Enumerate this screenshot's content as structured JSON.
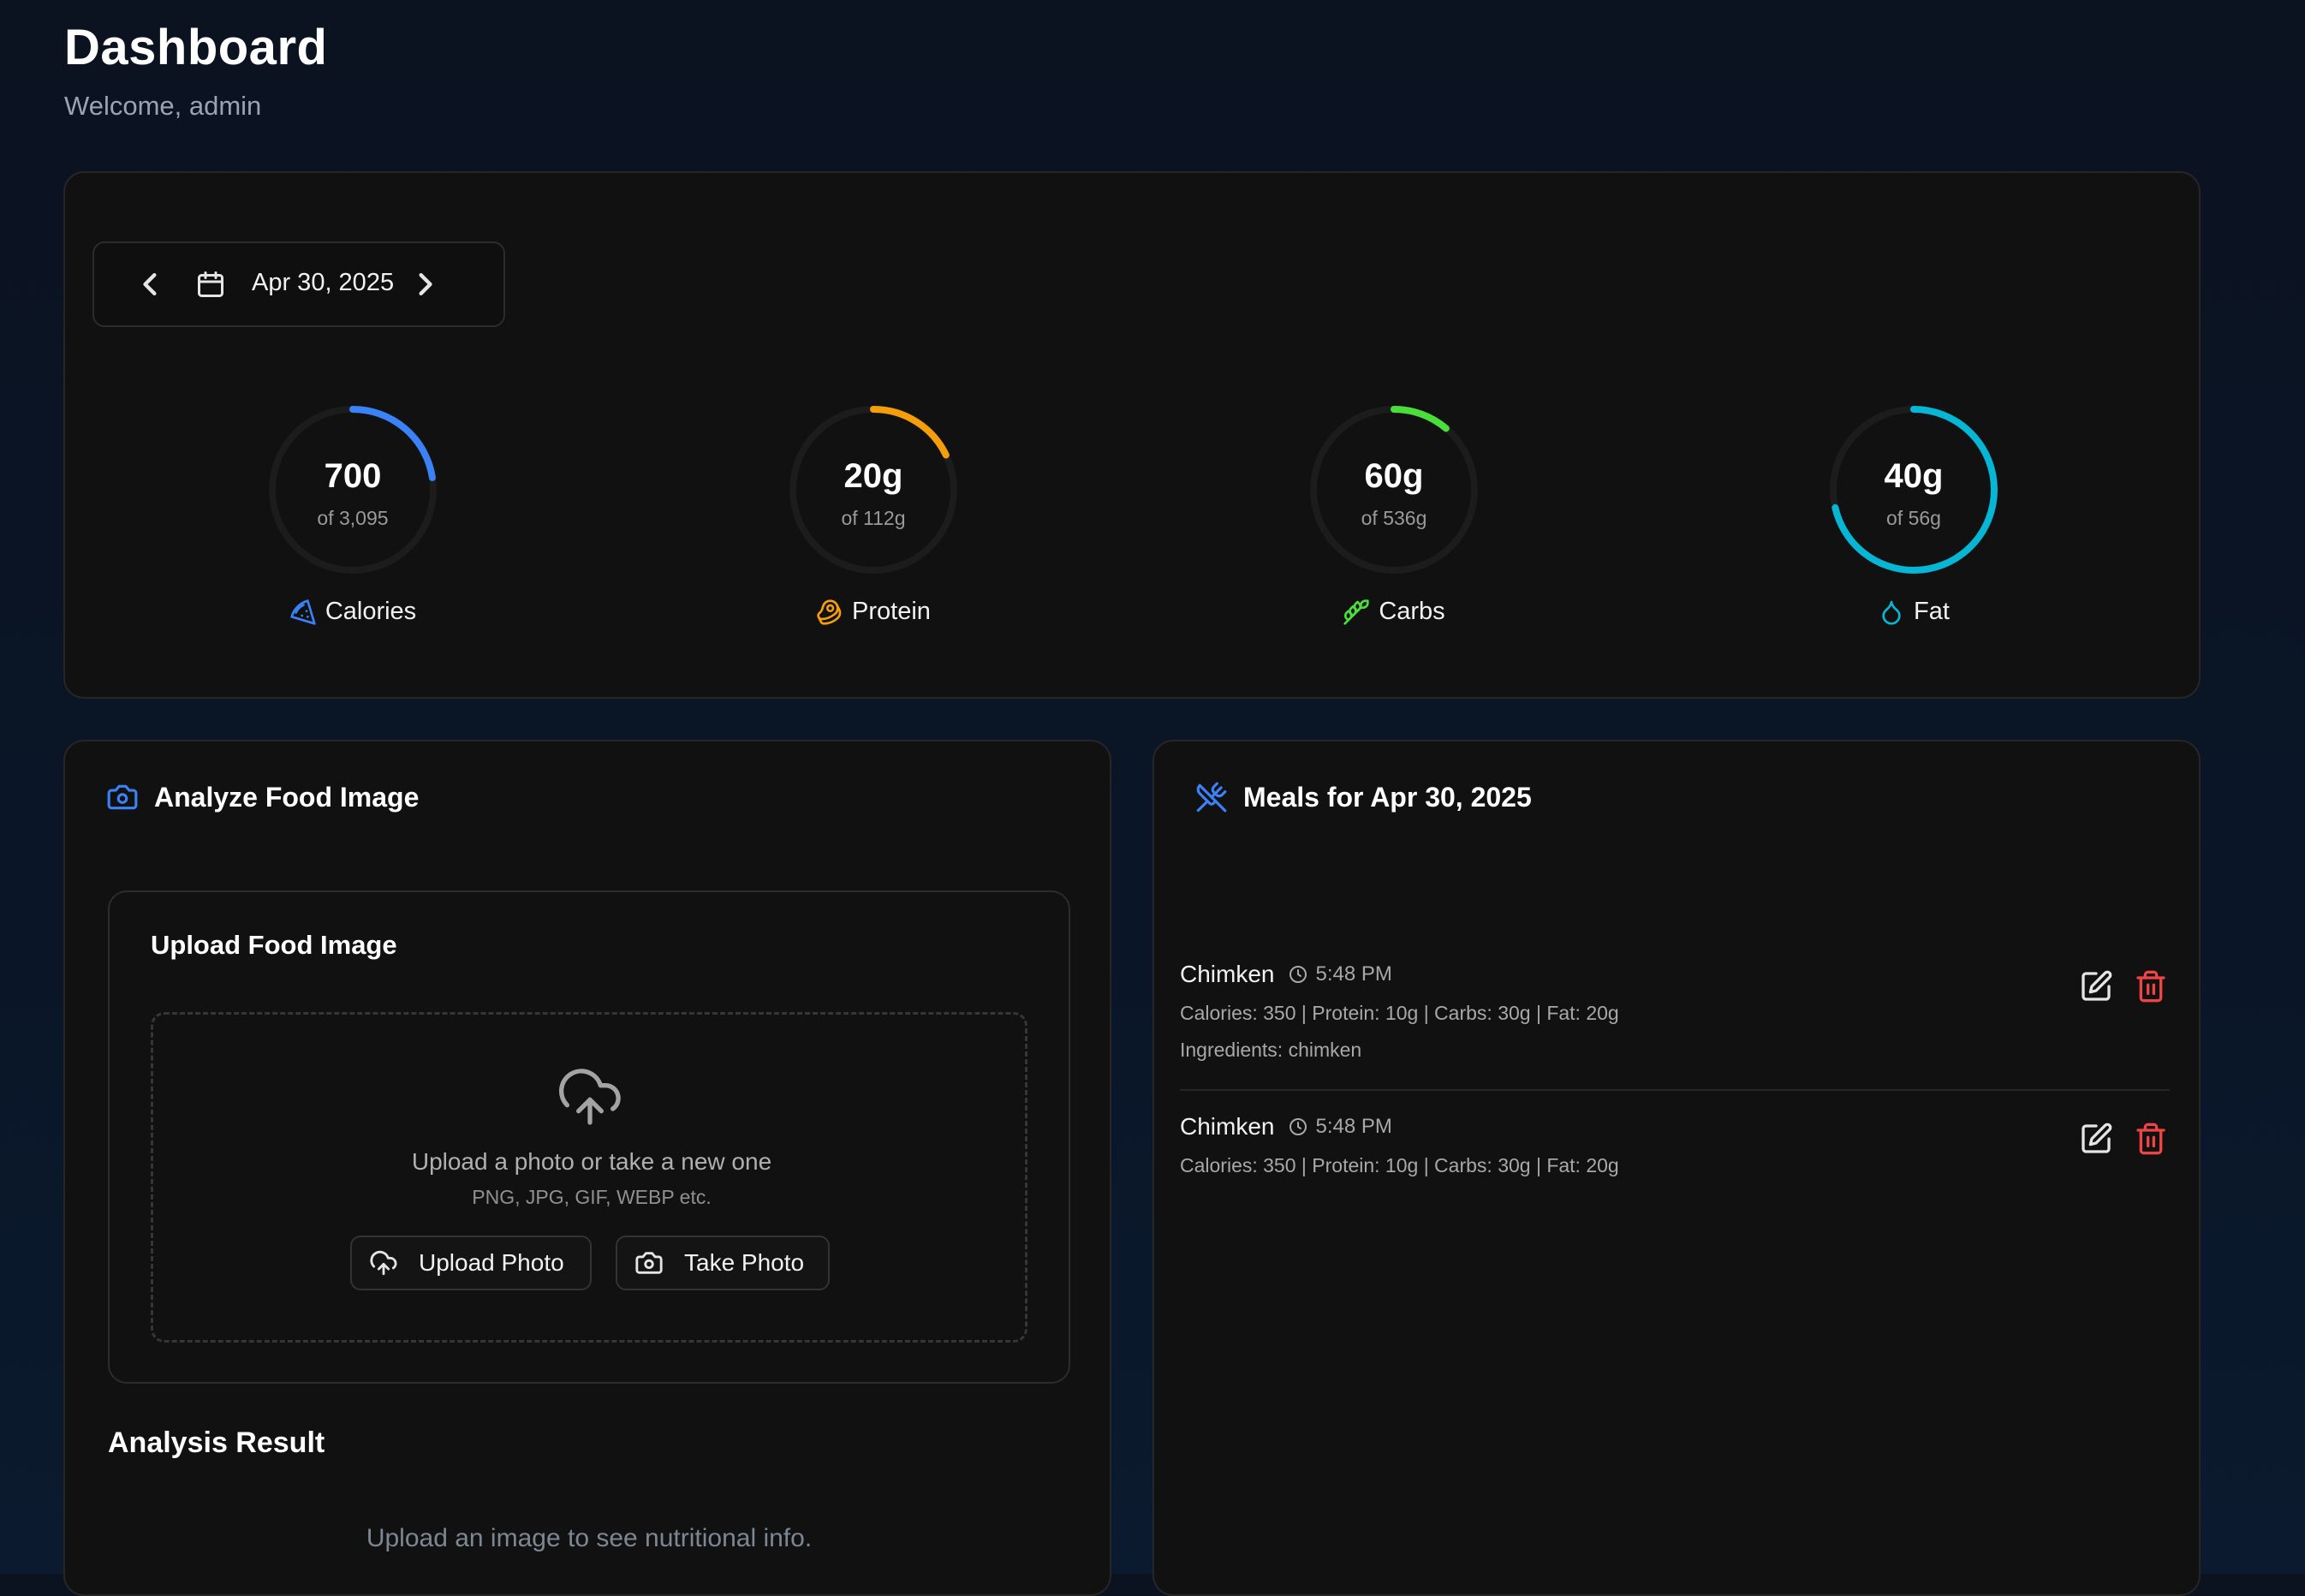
{
  "header": {
    "title": "Dashboard",
    "welcome": "Welcome, admin"
  },
  "date_picker": {
    "date": "Apr 30, 2025"
  },
  "stats": [
    {
      "id": "calories",
      "value": "700",
      "goal": "of 3,095",
      "label": "Calories",
      "color": "#3b82f6",
      "progress": 0.226
    },
    {
      "id": "protein",
      "value": "20g",
      "goal": "of 112g",
      "label": "Protein",
      "color": "#f59e0b",
      "progress": 0.179
    },
    {
      "id": "carbs",
      "value": "60g",
      "goal": "of 536g",
      "label": "Carbs",
      "color": "#4ade3a",
      "progress": 0.112
    },
    {
      "id": "fat",
      "value": "40g",
      "goal": "of 56g",
      "label": "Fat",
      "color": "#06b6d4",
      "progress": 0.714
    }
  ],
  "analyze": {
    "title": "Analyze Food Image",
    "upload_title": "Upload Food Image",
    "drop_text": "Upload a photo or take a new one",
    "formats": "PNG, JPG, GIF, WEBP etc.",
    "upload_button": "Upload Photo",
    "take_button": "Take Photo",
    "result_title": "Analysis Result",
    "result_hint": "Upload an image to see nutritional info."
  },
  "meals": {
    "title": "Meals for Apr 30, 2025",
    "items": [
      {
        "name": "Chimken",
        "time": "5:48 PM",
        "macros": "Calories: 350 | Protein: 10g | Carbs: 30g | Fat: 20g",
        "ingredients": "Ingredients: chimken"
      },
      {
        "name": "Chimken",
        "time": "5:48 PM",
        "macros": "Calories: 350 | Protein: 10g | Carbs: 30g | Fat: 20g"
      }
    ]
  },
  "colors": {
    "accent": "#3b82f6",
    "danger": "#ef4444",
    "card_bg": "#111111"
  }
}
